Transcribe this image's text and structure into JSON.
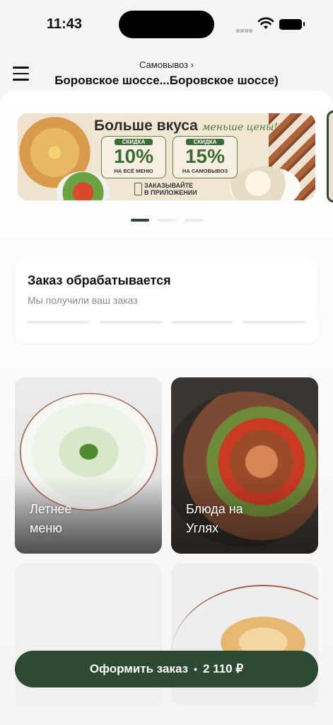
{
  "status_bar": {
    "time": "11:43"
  },
  "header": {
    "pickup_label": "Самовывоз ›",
    "address": "Боровское шоссе...Боровское шоссе)"
  },
  "promo_banner": {
    "title": "Больше вкуса",
    "slogan": "меньше цены!",
    "discount_1": {
      "tag": "СКИДКА",
      "percent": "10%",
      "note": "НА ВСЁ МЕНЮ"
    },
    "discount_2": {
      "tag": "СКИДКА",
      "percent": "15%",
      "note": "НА САМОВЫВОЗ"
    },
    "app_line_1": "ЗАКАЗЫВАЙТЕ",
    "app_line_2": "В ПРИЛОЖЕНИИ",
    "page_count": 3,
    "active_page": 1
  },
  "order_status": {
    "title": "Заказ обрабатывается",
    "subtitle": "Мы получили ваш заказ",
    "steps": 4,
    "completed_steps": 0
  },
  "categories": [
    {
      "line1": "Летнее",
      "line2": "меню"
    },
    {
      "line1": "Блюда на",
      "line2": "Углях"
    }
  ],
  "checkout": {
    "label": "Оформить заказ",
    "separator": "•",
    "total": "2 110 ₽"
  },
  "colors": {
    "accent": "#2b4a31",
    "background": "#f4f4f4"
  }
}
